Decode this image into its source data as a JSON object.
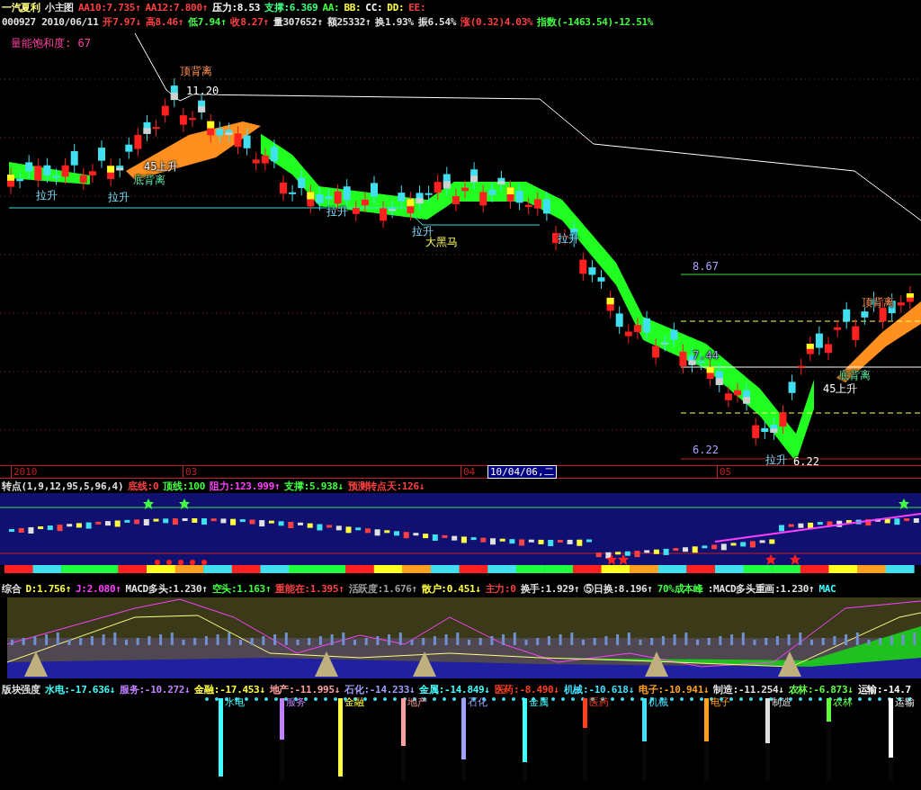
{
  "header_row_1": [
    {
      "text": "一汽夏利",
      "color": "#ffff80"
    },
    {
      "text": "小主图",
      "color": "#e0e0e0"
    },
    {
      "text": "AA10:7.735↑",
      "color": "#ff4040"
    },
    {
      "text": "AA12:7.800↑",
      "color": "#ff4040"
    },
    {
      "text": "压力:8.53",
      "color": "#ffffff"
    },
    {
      "text": "支撑:6.369",
      "color": "#40ff80"
    },
    {
      "text": "AA:",
      "color": "#40ff40"
    },
    {
      "text": "BB:",
      "color": "#ffff40"
    },
    {
      "text": "CC:",
      "color": "#ffffff"
    },
    {
      "text": "DD:",
      "color": "#ffff40"
    },
    {
      "text": "EE:",
      "color": "#ff4040"
    }
  ],
  "header_row_2": [
    {
      "text": "000927 2010/06/11",
      "color": "#e0e0e0"
    },
    {
      "text": "开7.97↓",
      "color": "#ff4040"
    },
    {
      "text": "高8.46↑",
      "color": "#ff4040"
    },
    {
      "text": "低7.94↑",
      "color": "#40ff40"
    },
    {
      "text": "收8.27↑",
      "color": "#ff4040"
    },
    {
      "text": "量307652↑",
      "color": "#e0e0e0"
    },
    {
      "text": "额25332↑",
      "color": "#e0e0e0"
    },
    {
      "text": "换1.93%",
      "color": "#e0e0e0"
    },
    {
      "text": "振6.54%",
      "color": "#e0e0e0"
    },
    {
      "text": "涨(0.32)4.03%",
      "color": "#ff4040"
    },
    {
      "text": "指数(-1463.54)-12.51%",
      "color": "#40ff40"
    }
  ],
  "main_chart": {
    "volume_label": "量能饱和度: 67",
    "annotations": [
      {
        "text": "顶背离",
        "kind": "top"
      },
      {
        "text": "11.20",
        "kind": "price"
      },
      {
        "text": "45上升",
        "kind": "rise"
      },
      {
        "text": "底背离",
        "kind": "bottom"
      },
      {
        "text": "拉升",
        "kind": "pull"
      },
      {
        "text": "拉升",
        "kind": "pull"
      },
      {
        "text": "拉升",
        "kind": "pull"
      },
      {
        "text": "拉升",
        "kind": "pull"
      },
      {
        "text": "大黑马",
        "kind": "horse"
      },
      {
        "text": "拉升",
        "kind": "pull"
      },
      {
        "text": "8.67",
        "kind": "level"
      },
      {
        "text": "顶背离",
        "kind": "top"
      },
      {
        "text": "7.44",
        "kind": "level"
      },
      {
        "text": "底背离",
        "kind": "bottom"
      },
      {
        "text": "45上升",
        "kind": "rise"
      },
      {
        "text": "6.22",
        "kind": "level"
      },
      {
        "text": "拉升",
        "kind": "pull"
      },
      {
        "text": "6.22",
        "kind": "price"
      }
    ]
  },
  "date_axis": {
    "labels": [
      "2010",
      "03",
      "04",
      "05"
    ],
    "cursor_date": "10/04/06,二"
  },
  "turning_panel": {
    "header": [
      {
        "text": "转点(1,9,12,95,5,96,4)",
        "color": "#e0e0e0"
      },
      {
        "text": "底线:0",
        "color": "#ff4040"
      },
      {
        "text": "顶线:100",
        "color": "#40ff40"
      },
      {
        "text": "阻力:123.999↑",
        "color": "#ff40ff"
      },
      {
        "text": "支撑:5.938↓",
        "color": "#40ff40"
      },
      {
        "text": "预测转点天:126↓",
        "color": "#ff4040"
      }
    ]
  },
  "composite_panel": {
    "header": [
      {
        "text": "综合",
        "color": "#e0e0e0"
      },
      {
        "text": "D:1.756↑",
        "color": "#ffff40"
      },
      {
        "text": "J:2.080↑",
        "color": "#ff40ff"
      },
      {
        "text": "MACD多头:1.230↑",
        "color": "#e0e0e0"
      },
      {
        "text": "空头:1.163↑",
        "color": "#40ff40"
      },
      {
        "text": "重能在:1.395↑",
        "color": "#ff4040"
      },
      {
        "text": "活跃度:1.676↑",
        "color": "#a0a0a0"
      },
      {
        "text": "散户:0.451↓",
        "color": "#ffff40"
      },
      {
        "text": "主力:0",
        "color": "#ff4040"
      },
      {
        "text": "换手:1.929↑",
        "color": "#e0e0e0"
      },
      {
        "text": "⑤日换:8.196↑",
        "color": "#e0e0e0"
      },
      {
        "text": "70%成本峰",
        "color": "#40ff40"
      },
      {
        "text": ":MACD多头重画:1.230↑",
        "color": "#e0e0e0"
      },
      {
        "text": "MAC",
        "color": "#40ffff"
      }
    ]
  },
  "sector_panel": {
    "header": [
      {
        "text": "版块强度",
        "color": "#e0e0e0"
      },
      {
        "text": "水电:-17.636↓",
        "color": "#40ffff"
      },
      {
        "text": "服务:-10.272↓",
        "color": "#c080ff"
      },
      {
        "text": "金融:-17.453↓",
        "color": "#ffff40"
      },
      {
        "text": "地产:-11.995↓",
        "color": "#ffa0a0"
      },
      {
        "text": "石化:-14.233↓",
        "color": "#a0a0ff"
      },
      {
        "text": "金属:-14.849↓",
        "color": "#40ffff"
      },
      {
        "text": "医药:-8.490↓",
        "color": "#ff4020"
      },
      {
        "text": "机械:-10.618↓",
        "color": "#40e0ff"
      },
      {
        "text": "电子:-10.941↓",
        "color": "#ffa020"
      },
      {
        "text": "制造:-11.254↓",
        "color": "#e0e0e0"
      },
      {
        "text": "农林:-6.873↓",
        "color": "#60ff40"
      },
      {
        "text": "运输:-14.7",
        "color": "#ffffff"
      }
    ],
    "bars": [
      {
        "label": "水电",
        "color": "#40ffff",
        "level": 0.95
      },
      {
        "label": "服务",
        "color": "#c080ff",
        "level": 0.5
      },
      {
        "label": "金融",
        "color": "#ffff40",
        "level": 0.95
      },
      {
        "label": "地产",
        "color": "#ffa0a0",
        "level": 0.58
      },
      {
        "label": "石化",
        "color": "#a0a0ff",
        "level": 0.74
      },
      {
        "label": "金属",
        "color": "#40ffff",
        "level": 0.77
      },
      {
        "label": "医药",
        "color": "#ff4020",
        "level": 0.36
      },
      {
        "label": "机械",
        "color": "#40e0ff",
        "level": 0.52
      },
      {
        "label": "电子",
        "color": "#ffa020",
        "level": 0.52
      },
      {
        "label": "制造",
        "color": "#e0e0e0",
        "level": 0.54
      },
      {
        "label": "农林",
        "color": "#60ff40",
        "level": 0.28
      },
      {
        "label": "运输",
        "color": "#ffffff",
        "level": 0.72
      }
    ]
  }
}
